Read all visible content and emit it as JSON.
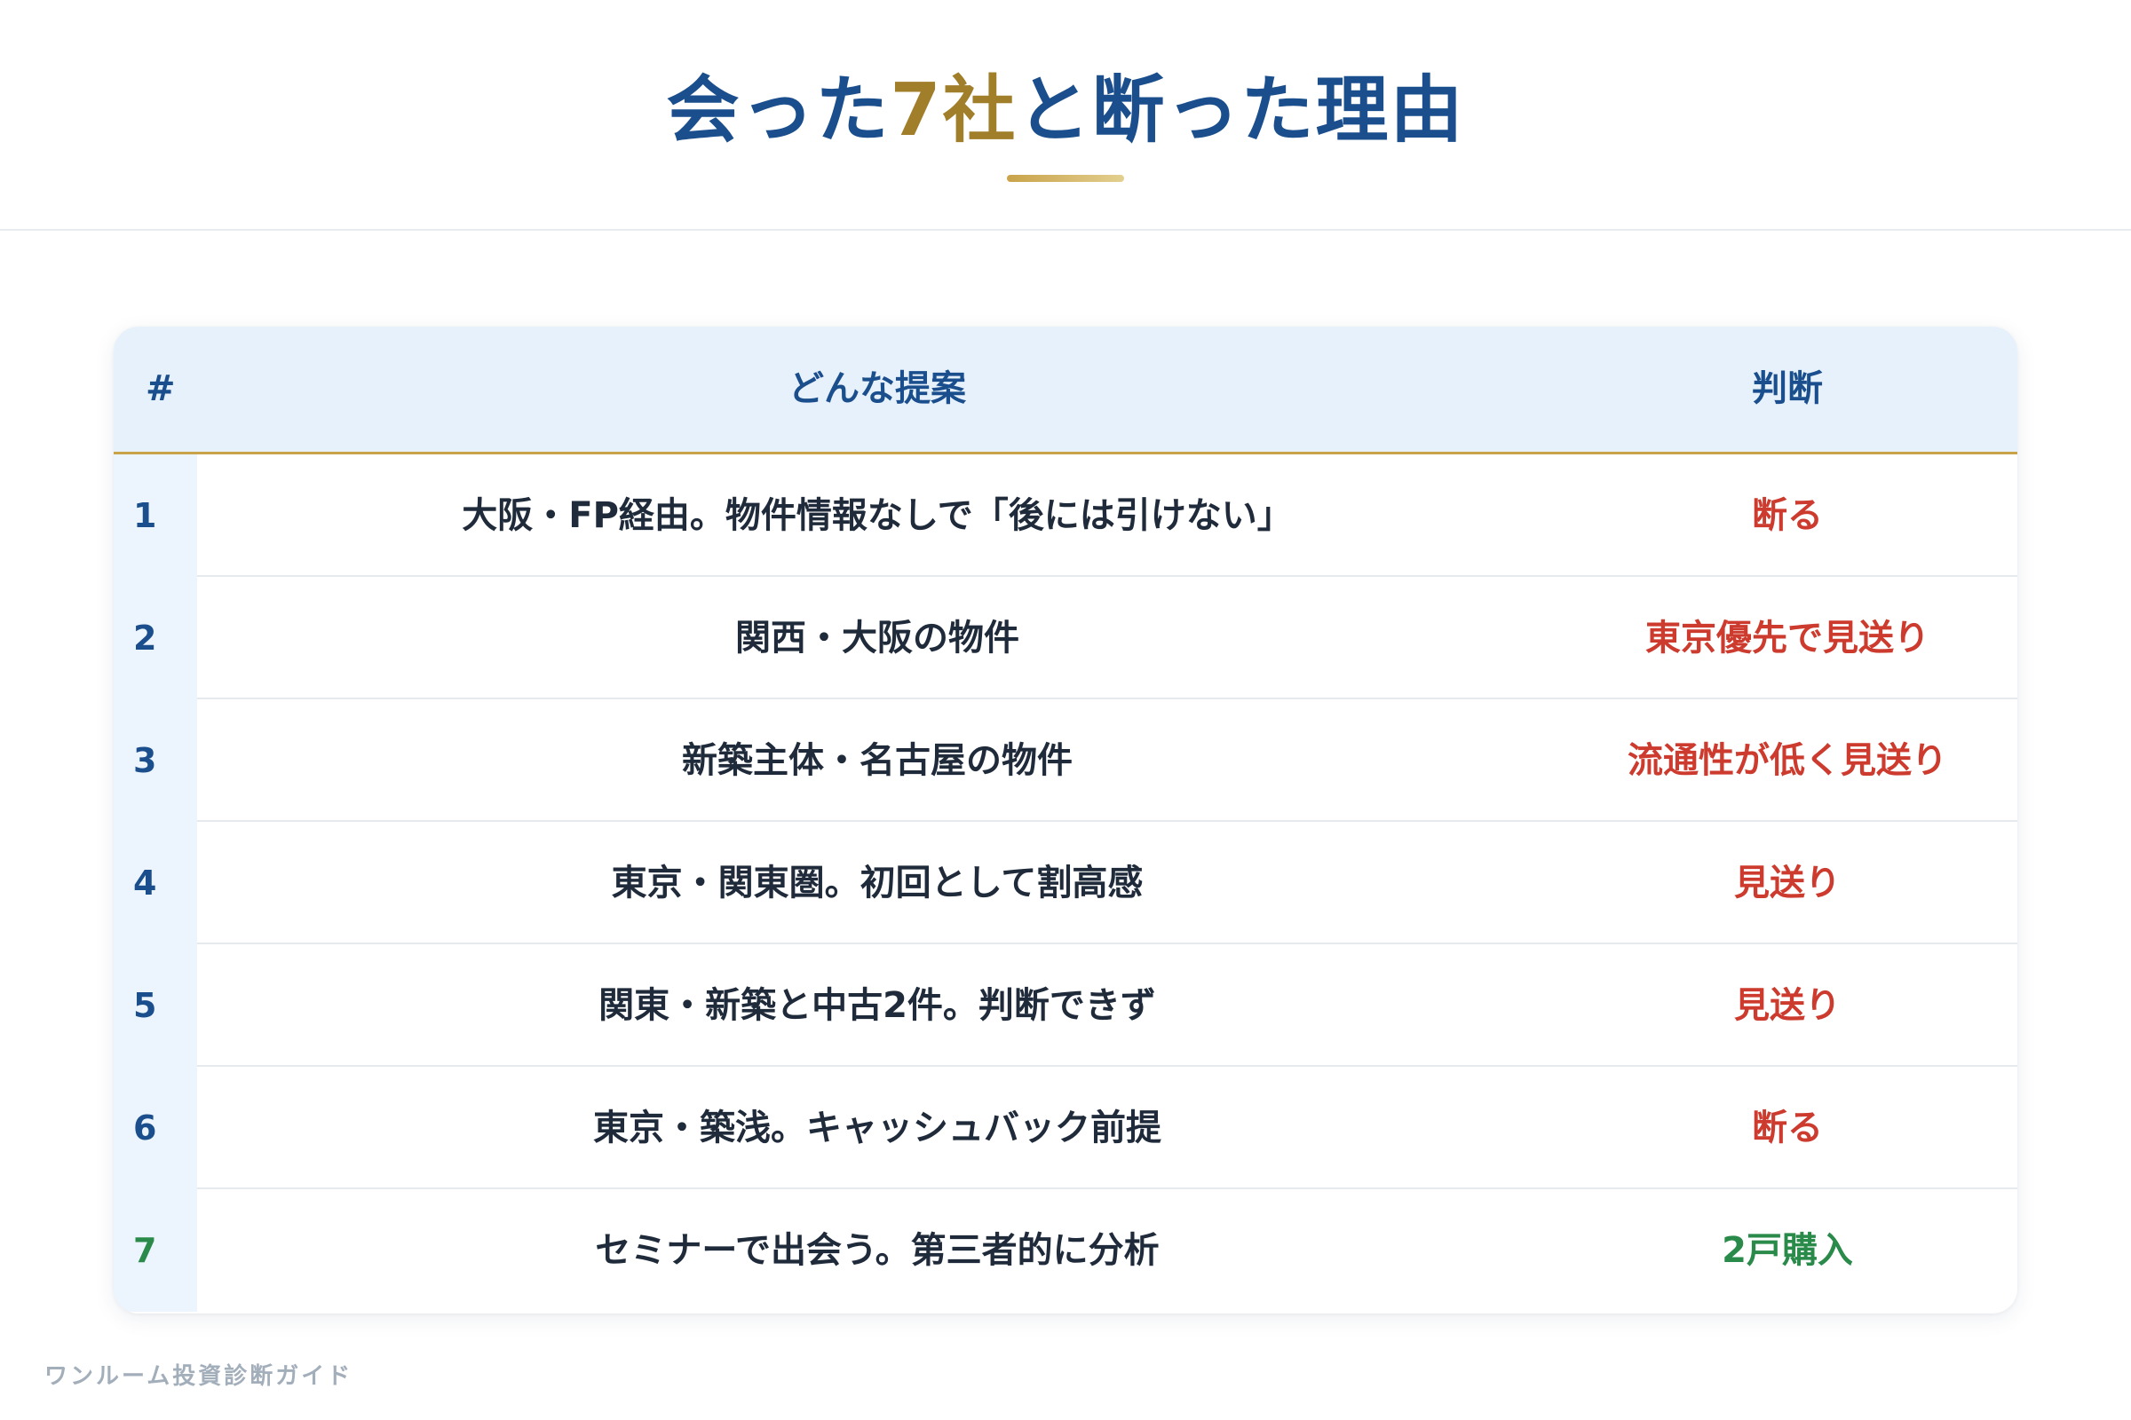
{
  "header": {
    "title_part1": "会った",
    "title_accent": "7社",
    "title_part2": "と断った理由"
  },
  "table": {
    "columns": {
      "number": "#",
      "proposal": "どんな提案",
      "judgment": "判断"
    },
    "rows": [
      {
        "number": "1",
        "proposal": "大阪・FP経由。物件情報なしで「後には引けない」",
        "judgment": "断る",
        "status": "negative"
      },
      {
        "number": "2",
        "proposal": "関西・大阪の物件",
        "judgment": "東京優先で見送り",
        "status": "negative"
      },
      {
        "number": "3",
        "proposal": "新築主体・名古屋の物件",
        "judgment": "流通性が低く見送り",
        "status": "negative"
      },
      {
        "number": "4",
        "proposal": "東京・関東圏。初回として割高感",
        "judgment": "見送り",
        "status": "negative"
      },
      {
        "number": "5",
        "proposal": "関東・新築と中古2件。判断できず",
        "judgment": "見送り",
        "status": "negative"
      },
      {
        "number": "6",
        "proposal": "東京・築浅。キャッシュバック前提",
        "judgment": "断る",
        "status": "negative"
      },
      {
        "number": "7",
        "proposal": "セミナーで出会う。第三者的に分析",
        "judgment": "2戸購入",
        "status": "positive"
      }
    ]
  },
  "footer": {
    "brand": "ワンルーム投資診断ガイド"
  },
  "colors": {
    "primary": "#1a4e8c",
    "accent_gold": "#a07e2a",
    "negative": "#cc3b2e",
    "positive": "#2a8a4a"
  }
}
